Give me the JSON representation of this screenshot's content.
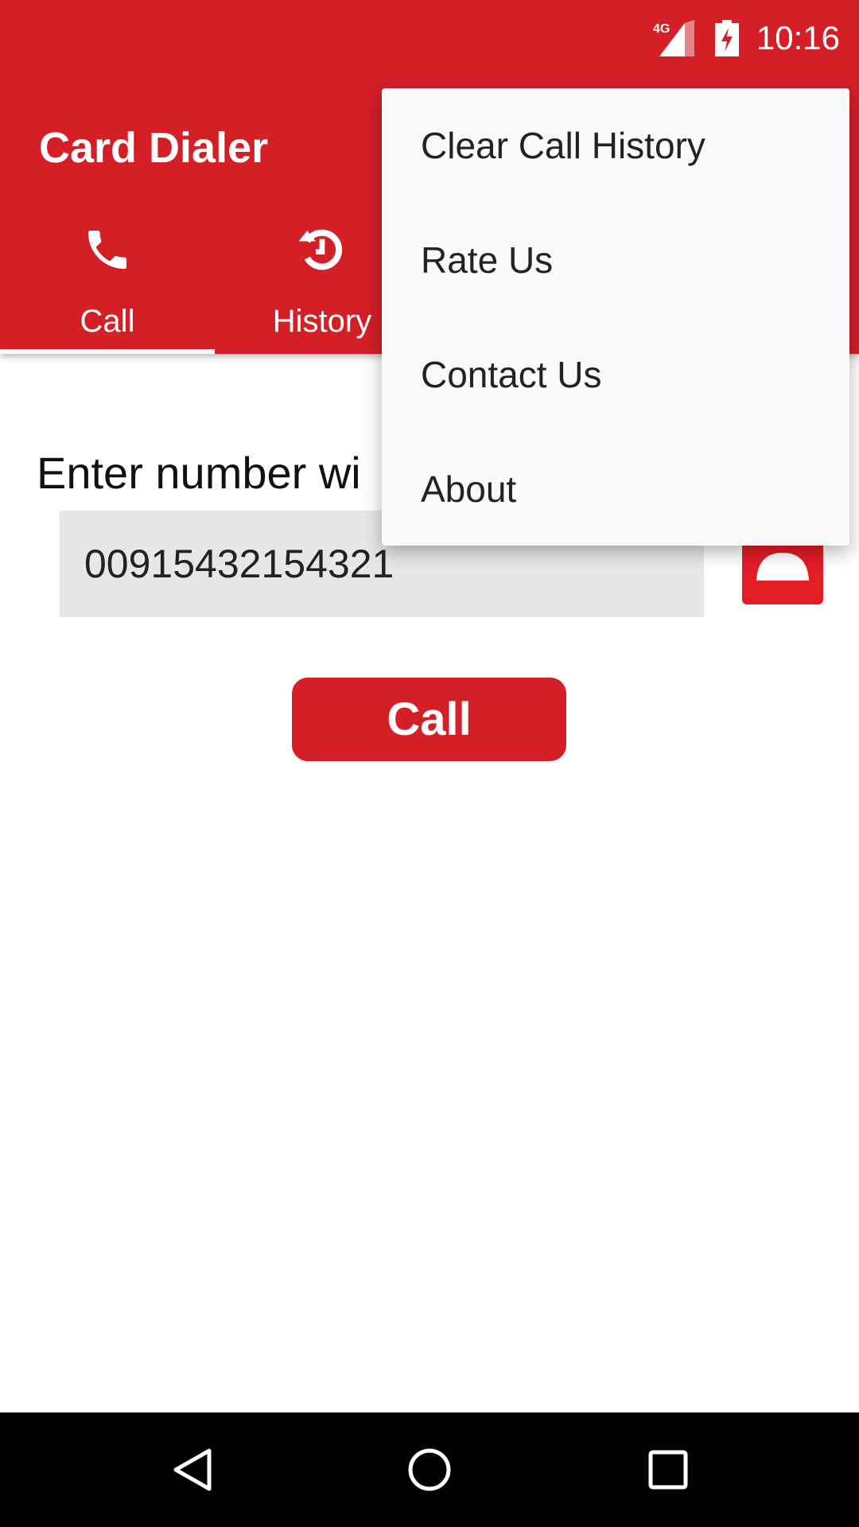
{
  "status_bar": {
    "network": "4G",
    "time": "10:16"
  },
  "app": {
    "title": "Card Dialer",
    "accent": "#d41f27"
  },
  "tabs": [
    {
      "label": "Call",
      "icon": "phone-icon",
      "selected": true
    },
    {
      "label": "History",
      "icon": "history-icon",
      "selected": false
    }
  ],
  "main": {
    "label": "Enter number wi",
    "number": "00915432154321",
    "call_button": "Call",
    "contact_icon": "contact-icon"
  },
  "menu": {
    "items": [
      "Clear Call History",
      "Rate Us",
      "Contact Us",
      "About"
    ]
  },
  "nav": {
    "back": "back-icon",
    "home": "home-icon",
    "recents": "recents-icon"
  }
}
